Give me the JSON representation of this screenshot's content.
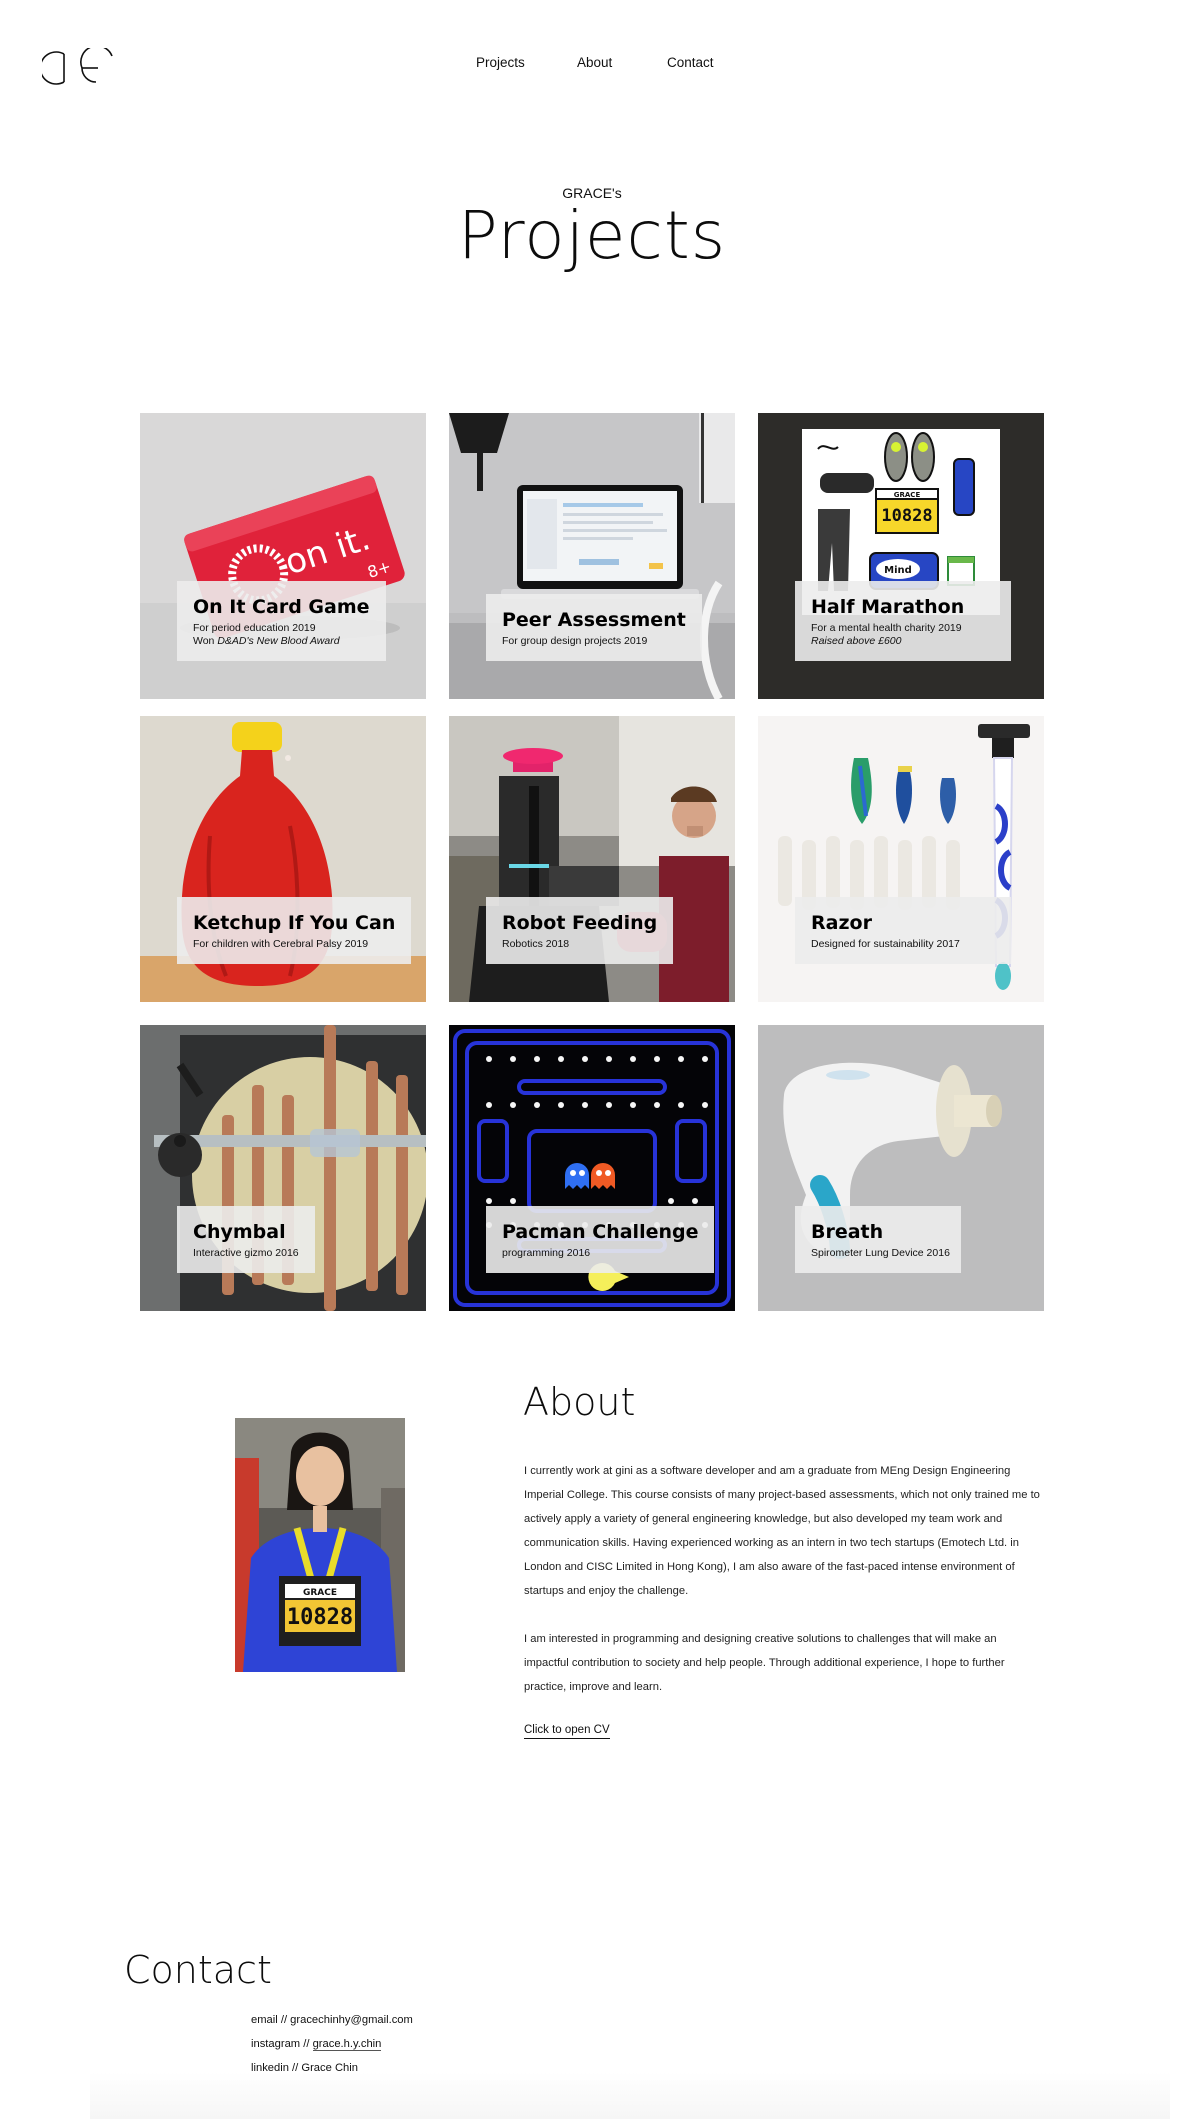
{
  "header": {
    "logo_text": "GC",
    "nav": [
      {
        "label": "Projects"
      },
      {
        "label": "About"
      },
      {
        "label": "Contact"
      }
    ]
  },
  "hero": {
    "kicker": "GRACE's",
    "title": "Projects"
  },
  "projects": [
    {
      "title": "On It Card Game",
      "line1": "For period education 2019",
      "line2_prefix": "Won ",
      "line2_italic": "D&AD's New Blood Award",
      "box_text": "on it.",
      "box_badge": "8+"
    },
    {
      "title": "Peer Assessment",
      "line1": "For group design projects 2019"
    },
    {
      "title": "Half Marathon",
      "line1": "For a mental health charity 2019",
      "line2_italic": "Raised above £600",
      "bib_name": "GRACE",
      "bib_number": "10828",
      "bag_text": "Mind"
    },
    {
      "title": "Ketchup If You Can",
      "line1": "For children with Cerebral Palsy 2019"
    },
    {
      "title": "Robot Feeding",
      "line1": "Robotics 2018"
    },
    {
      "title": "Razor",
      "line1": "Designed for sustainability 2017"
    },
    {
      "title": "Chymbal",
      "line1": "Interactive gizmo 2016"
    },
    {
      "title": "Pacman Challenge",
      "line1": "programming 2016"
    },
    {
      "title": "Breath",
      "line1": "Spirometer Lung Device 2016"
    }
  ],
  "about": {
    "title": "About",
    "paragraphs": [
      "I currently work at gini as a software developer and am a graduate from MEng Design Engineering Imperial College. This course consists of many project-based assessments, which not only trained me to actively apply a variety of general engineering knowledge, but also developed my team work and communication skills. Having experienced working as an intern in two tech startups (Emotech Ltd. in London and CISC Limited in Hong Kong), I am also aware of the fast-paced intense environment of startups and enjoy the challenge.",
      "I am interested in programming and designing creative solutions to challenges that will make an impactful contribution to society and help people. Through additional experience, I hope to further practice, improve and learn."
    ],
    "cv_link": "Click to open CV",
    "photo_bib_name": "GRACE",
    "photo_bib_number": "10828"
  },
  "contact": {
    "title": "Contact",
    "email_label": "email // ",
    "email": "gracechinhy@gmail.com",
    "instagram_label": "instagram // ",
    "instagram": "grace.h.y.chin",
    "linkedin_label": "linkedin // ",
    "linkedin": "Grace Chin"
  },
  "colors": {
    "background": "#ffffff",
    "text": "#111111",
    "card": "#ececec"
  }
}
